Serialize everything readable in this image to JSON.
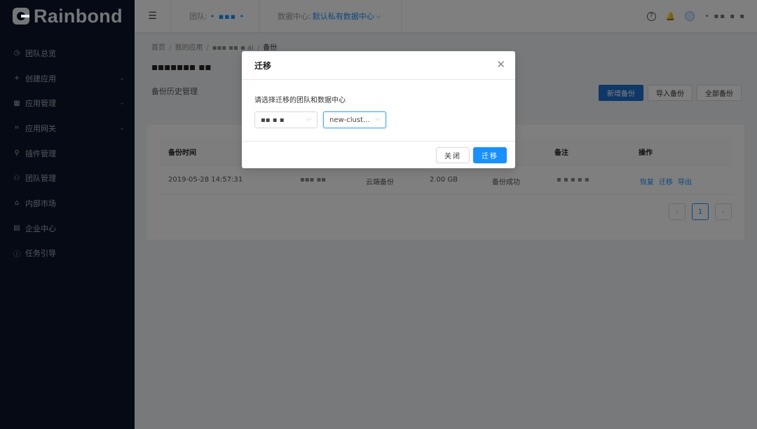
{
  "sidebar": {
    "brand": "Rainbond",
    "items": [
      {
        "label": "团队总览",
        "icon": "dashboard-icon",
        "glyph": "◷",
        "expand": false
      },
      {
        "label": "创建应用",
        "icon": "plus-icon",
        "glyph": "+",
        "expand": true
      },
      {
        "label": "应用管理",
        "icon": "appstore-icon",
        "glyph": "▦",
        "expand": true
      },
      {
        "label": "应用网关",
        "icon": "gateway-icon",
        "glyph": "⌗",
        "expand": true
      },
      {
        "label": "插件管理",
        "icon": "api-icon",
        "glyph": "⚲",
        "expand": false
      },
      {
        "label": "团队管理",
        "icon": "team-icon",
        "glyph": "⚇",
        "expand": false
      },
      {
        "label": "内部市场",
        "icon": "shop-icon",
        "glyph": "⌂",
        "expand": false
      },
      {
        "label": "企业中心",
        "icon": "enterprise-icon",
        "glyph": "▤",
        "expand": false
      },
      {
        "label": "任务引导",
        "icon": "info-icon",
        "glyph": "ⓘ",
        "expand": false
      }
    ],
    "expand_glyph": "⌄"
  },
  "header": {
    "fold_glyph": "☰",
    "team_label": "团队:",
    "team_value": "• ▪▪▪ •",
    "dc_label": "数据中心:",
    "dc_value": "默认私有数据中心",
    "dc_chevron": "⌵",
    "help_glyph": "?",
    "bell_glyph": "🔔",
    "username": "• ▪▪ ▪ ▪"
  },
  "breadcrumb": {
    "home": "首页",
    "apps": "我的应用",
    "app": "▪▪▪ ▪▪ ▪ ai",
    "current": "备份",
    "sep": "/"
  },
  "page": {
    "title": "▪▪▪▪▪▪▪ ▪▪",
    "subtitle": "备份历史管理",
    "btn_new": "新增备份",
    "btn_import": "导入备份",
    "btn_all": "全部备份"
  },
  "table": {
    "headers": {
      "time": "备份时间",
      "note": "备注",
      "actions": "操作"
    },
    "rows": [
      {
        "time": "2019-05-28 14:57:31",
        "user": "▪▪▪ ▪▪",
        "mode": "云端备份",
        "size": "2.00 GB",
        "status": "备份成功",
        "note": "▪ ▪ ▪ ▪ ▪",
        "restore": "恢复",
        "migrate": "迁移",
        "export": "导出"
      }
    ]
  },
  "pagination": {
    "prev": "‹",
    "current": "1",
    "next": "›"
  },
  "modal": {
    "title": "迁移",
    "close_glyph": "✕",
    "description": "请选择迁移的团队和数据中心",
    "team_select": "▪▪ ▪ ▪",
    "cluster_select": "new-clust...",
    "select_chevron": "⌵",
    "cancel": "关闭",
    "ok": "迁移"
  }
}
